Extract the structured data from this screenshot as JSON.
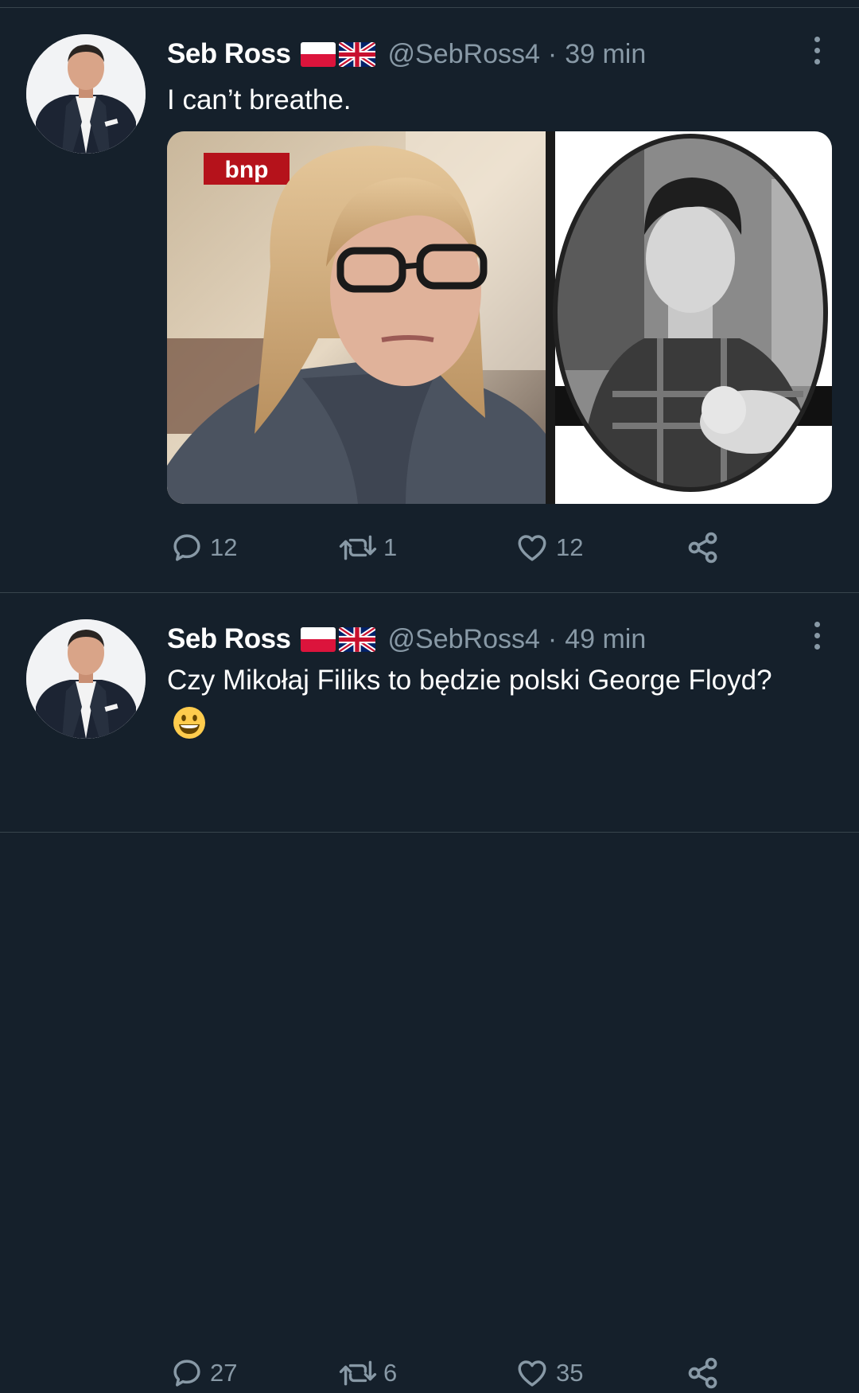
{
  "tweets": [
    {
      "author": {
        "name": "Seb Ross",
        "handle": "@SebRoss4"
      },
      "separator": "·",
      "time": "39 min",
      "text": "I can’t breathe.",
      "media": {
        "watermark": "bnp"
      },
      "stats": {
        "replies": "12",
        "retweets": "1",
        "likes": "12"
      }
    },
    {
      "author": {
        "name": "Seb Ross",
        "handle": "@SebRoss4"
      },
      "separator": "·",
      "time": "49 min",
      "text": "Czy Mikołaj Filiks to będzie polski George Floyd?",
      "stats": {
        "replies": "27",
        "retweets": "6",
        "likes": "35"
      }
    }
  ],
  "colors": {
    "background": "#15202b",
    "secondary_text": "#8899a6",
    "divider": "#38444d",
    "flag_red": "#dc143c"
  },
  "icons": [
    "flag-poland-icon",
    "flag-uk-icon",
    "more-options-icon",
    "reply-icon",
    "retweet-icon",
    "like-icon",
    "share-icon",
    "smiley-emoji-icon"
  ]
}
